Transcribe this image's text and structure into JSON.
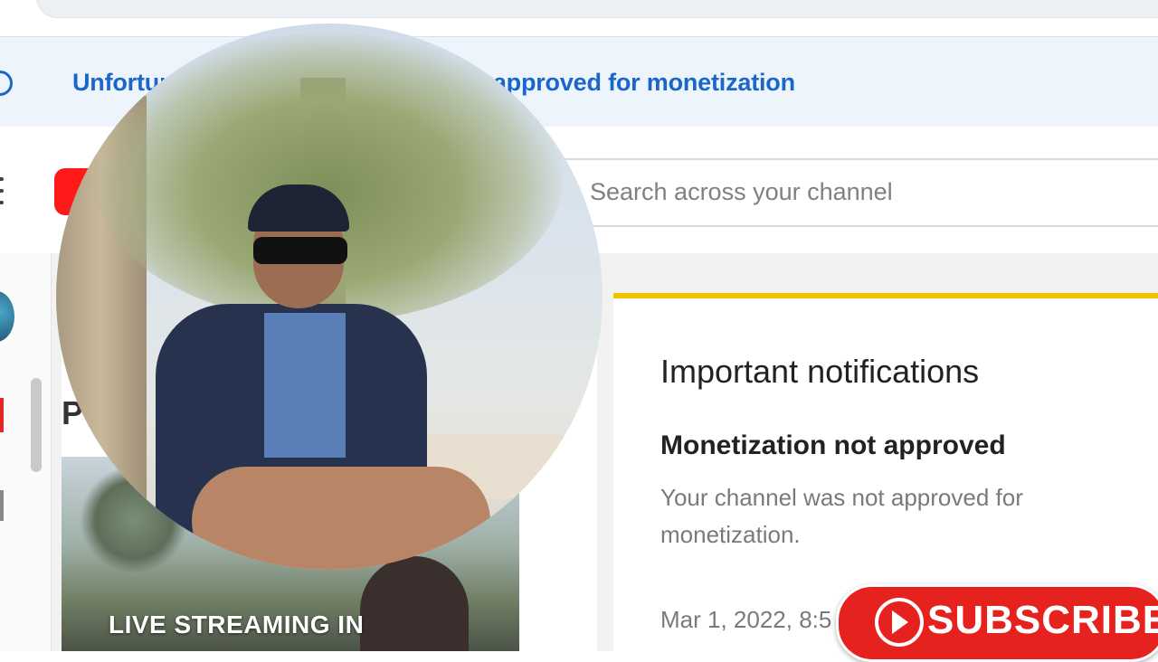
{
  "banner": {
    "text": "Unfortunately, your channel was not approved for monetization",
    "icon": "info-icon"
  },
  "header": {
    "menu_icon": "menu-icon",
    "logo_icon": "youtube-logo-icon",
    "search_placeholder": "Search across your channel"
  },
  "sidebar": {
    "items": [
      "avatar",
      "content",
      "more"
    ]
  },
  "main": {
    "heading_initial": "P",
    "thumbnail_caption": "LIVE STREAMING IN"
  },
  "notifications": {
    "title": "Important notifications",
    "item_title": "Monetization not approved",
    "item_desc": "Your channel was not approved for monetization.",
    "item_date": "Mar 1, 2022, 8:5"
  },
  "overlay": {
    "subscribe_label": "SUBSCRIBE",
    "subscribe_icon": "play-icon"
  },
  "colors": {
    "banner_text": "#1a66c9",
    "notif_accent": "#f2c200",
    "subscribe_bg": "#e6221f"
  }
}
